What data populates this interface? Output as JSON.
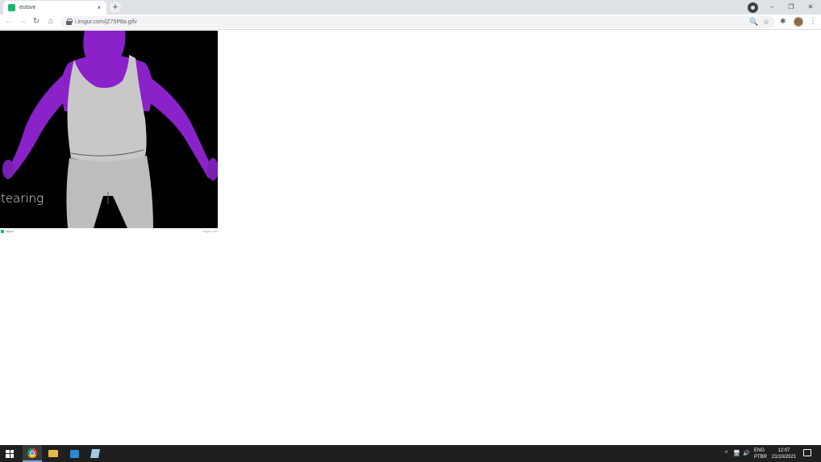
{
  "browser": {
    "tab": {
      "title": "eulsvir",
      "favicon": "imgur-favicon",
      "close": "×"
    },
    "new_tab": "+",
    "window_controls": {
      "minimize": "–",
      "restore": "❐",
      "close": "✕"
    },
    "toolbar": {
      "back": "←",
      "forward": "→",
      "reload": "↻",
      "home": "⌂",
      "url": "i.imgur.com/jZ75P8a.gifv",
      "zoom_icon": "🔍",
      "bookmark_icon": "☆",
      "extensions_icon": "✱",
      "menu": "⋮"
    }
  },
  "page": {
    "gif_caption": "tearing",
    "footer_left": "imgur",
    "footer_right": "imgur.com",
    "figure_colors": {
      "skin": "#8b22c9",
      "garment": "#c8c8c8",
      "background": "#000000"
    }
  },
  "taskbar": {
    "apps": [
      "start",
      "chrome",
      "file-explorer",
      "outlook",
      "app"
    ],
    "tray_chevron": "^",
    "tray_network": "🖥",
    "tray_volume": "🔊",
    "language": {
      "line1": "ENG",
      "line2": "PTBR"
    },
    "time": "12:07",
    "date": "21/10/2021"
  }
}
